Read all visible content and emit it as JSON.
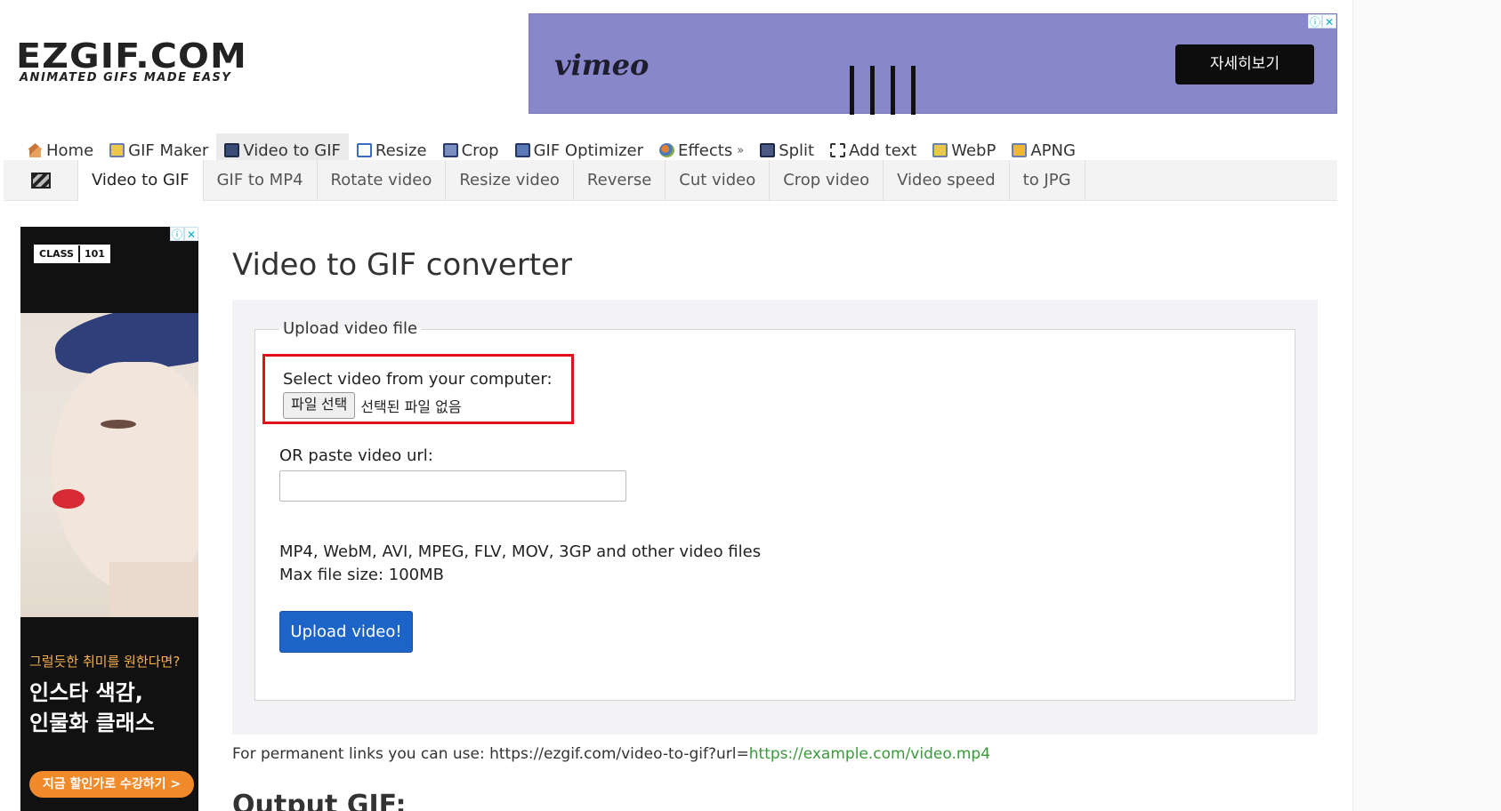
{
  "logo": {
    "main": "EZGIF.COM",
    "tagline": "ANIMATED GIFS MADE EASY"
  },
  "top_ad": {
    "brand": "vimeo",
    "cta": "자세히보기"
  },
  "main_nav": {
    "items": [
      {
        "label": "Home",
        "icon": "home-icon"
      },
      {
        "label": "GIF Maker",
        "icon": "gif-maker-icon"
      },
      {
        "label": "Video to GIF",
        "icon": "video-icon"
      },
      {
        "label": "Resize",
        "icon": "resize-icon"
      },
      {
        "label": "Crop",
        "icon": "crop-icon"
      },
      {
        "label": "GIF Optimizer",
        "icon": "optimizer-icon"
      },
      {
        "label": "Effects",
        "more": "»",
        "icon": "effects-icon"
      },
      {
        "label": "Split",
        "icon": "split-icon"
      },
      {
        "label": "Add text",
        "icon": "add-text-icon"
      },
      {
        "label": "WebP",
        "icon": "webp-icon"
      },
      {
        "label": "APNG",
        "icon": "apng-icon"
      }
    ],
    "active": "Video to GIF"
  },
  "sub_nav": {
    "icon": "clapperboard-icon",
    "items": [
      {
        "label": "Video to GIF"
      },
      {
        "label": "GIF to MP4"
      },
      {
        "label": "Rotate video"
      },
      {
        "label": "Resize video"
      },
      {
        "label": "Reverse"
      },
      {
        "label": "Cut video"
      },
      {
        "label": "Crop video"
      },
      {
        "label": "Video speed"
      },
      {
        "label": "to JPG"
      }
    ],
    "active": "Video to GIF"
  },
  "side_ad": {
    "logo_left": "CLASS",
    "logo_right": "101",
    "line1": "그럴듯한 취미를 원한다면?",
    "line2": "인스타 색감,",
    "line3": "인물화 클래스",
    "cta": "지금 할인가로 수강하기 >"
  },
  "content": {
    "title": "Video to GIF converter",
    "legend": "Upload video file",
    "select_label": "Select video from your computer:",
    "file_button": "파일 선택",
    "file_status": "선택된 파일 없음",
    "url_label": "OR paste video url:",
    "url_value": "",
    "url_placeholder": "",
    "formats_line1": "MP4, WebM, AVI, MPEG, FLV, MOV, 3GP and other video files",
    "formats_line2": "Max file size: 100MB",
    "upload_button": "Upload video!",
    "perm_prefix": "For permanent links you can use: https://ezgif.com/video-to-gif?url=",
    "perm_link": "https://example.com/video.mp4",
    "output_title": "Output GIF:"
  },
  "colors": {
    "accent_blue": "#1c64c8",
    "highlight_red": "#e0111b",
    "link_green": "#3a9a3a",
    "ad_purple": "#8787c9"
  }
}
